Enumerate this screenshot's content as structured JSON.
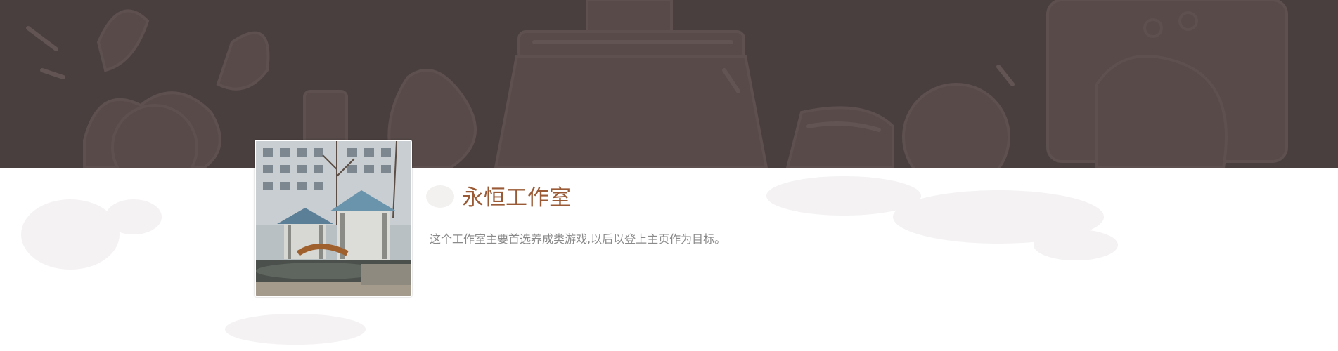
{
  "banner": {
    "background_color": "#4a3f3f",
    "decor_color": "#5a4c4b",
    "illustration": "cartoon-doodles"
  },
  "studio": {
    "name": "永恒工作室",
    "description": "这个工作室主要首选养成类游戏,以后以登上主页作为目标。",
    "name_color": "#9a5a35",
    "description_color": "#8a8a8a",
    "avatar": "pavilion-photo"
  }
}
